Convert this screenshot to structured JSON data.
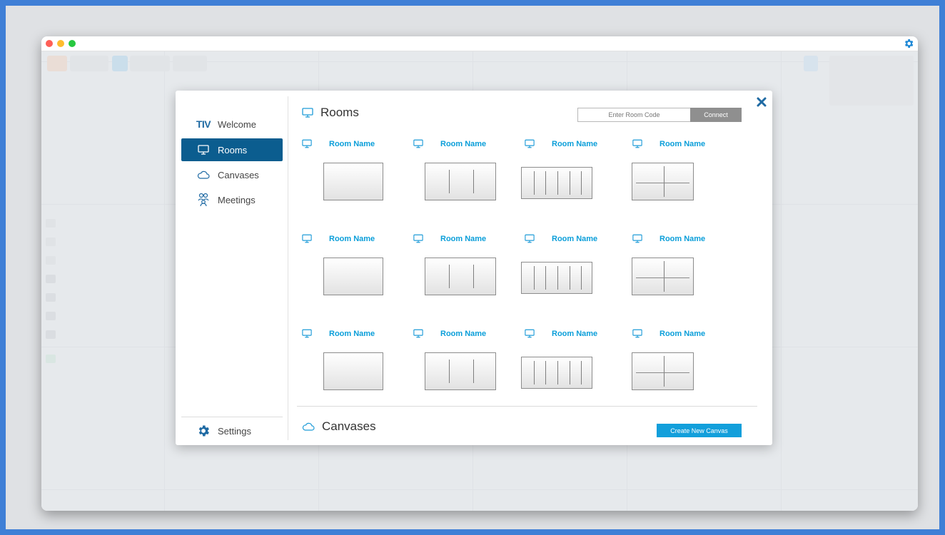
{
  "sidebar": {
    "logo": "TIV",
    "items": [
      {
        "label": "Welcome",
        "icon": "tiv-logo-icon"
      },
      {
        "label": "Rooms",
        "icon": "monitor-icon"
      },
      {
        "label": "Canvases",
        "icon": "cloud-icon"
      },
      {
        "label": "Meetings",
        "icon": "people-icon"
      }
    ],
    "settings_label": "Settings"
  },
  "rooms": {
    "title": "Rooms",
    "room_code_placeholder": "Enter Room Code",
    "connect_label": "Connect",
    "items": [
      {
        "name": "Room Name",
        "layout": "single"
      },
      {
        "name": "Room Name",
        "layout": "three-col"
      },
      {
        "name": "Room Name",
        "layout": "six-col"
      },
      {
        "name": "Room Name",
        "layout": "quad"
      },
      {
        "name": "Room Name",
        "layout": "single"
      },
      {
        "name": "Room Name",
        "layout": "three-col"
      },
      {
        "name": "Room Name",
        "layout": "six-col"
      },
      {
        "name": "Room Name",
        "layout": "quad"
      },
      {
        "name": "Room Name",
        "layout": "single"
      },
      {
        "name": "Room Name",
        "layout": "three-col"
      },
      {
        "name": "Room Name",
        "layout": "six-col"
      },
      {
        "name": "Room Name",
        "layout": "quad"
      }
    ]
  },
  "canvases": {
    "title": "Canvases",
    "create_label": "Create New Canvas"
  },
  "colors": {
    "accent": "#129fdb",
    "sidebar_active": "#0b5d8f",
    "room_name": "#0a9ed9",
    "close": "#1f6aa3",
    "frame": "#3f7fd6"
  }
}
